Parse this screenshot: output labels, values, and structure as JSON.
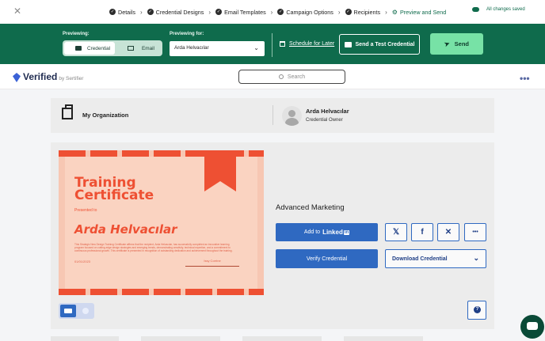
{
  "topbar": {
    "close_glyph": "✕",
    "steps": [
      {
        "label": "Details",
        "state": "done"
      },
      {
        "label": "Credential Designs",
        "state": "done"
      },
      {
        "label": "Email Templates",
        "state": "done"
      },
      {
        "label": "Campaign Options",
        "state": "done"
      },
      {
        "label": "Recipients",
        "state": "done"
      },
      {
        "label": "Preview and Send",
        "state": "active"
      }
    ],
    "saved_text": "All changes saved"
  },
  "preview": {
    "previewing_label": "Previewing:",
    "options": [
      "Credential",
      "Email"
    ],
    "selected_option": "Credential",
    "previewing_for_label": "Previewing for:",
    "recipient": "Arda Helvacılar",
    "schedule_label": "Schedule for Later",
    "test_label": "Send a Test Credential",
    "send_label": "Send"
  },
  "header": {
    "brand": "Verified",
    "brand_by": "by Sertifier",
    "search_placeholder": "Search",
    "more_glyph": "•••"
  },
  "org": {
    "name": "My Organization",
    "owner_name": "Arda Helvacılar",
    "owner_role": "Credential Owner"
  },
  "certificate": {
    "title_line1": "Training",
    "title_line2": "Certificate",
    "presented_to": "Presented to",
    "recipient": "Arda Helvacılar",
    "body": "This Strategic New Design Training Certificate affirms that the recipient, Arda Helvacılar, has successfully completed an innovative learning program focused on cutting-edge design strategies and emerging trends, demonstrating creativity, technical expertise, and a commitment to continuous professional growth. This certificate is presented in recognition of outstanding dedication and achievement throughout the training.",
    "date": "01/01/2023",
    "signature": "Issy Corrine",
    "accent_color": "#ee5033"
  },
  "credential": {
    "title": "Advanced Marketing",
    "linkedin_prefix": "Add to",
    "linkedin_word": "Linked",
    "linkedin_in": "in",
    "share_x": "𝕏",
    "share_fb": "f",
    "share_xing": "✕",
    "share_more": "•••",
    "verify_label": "Verify Credential",
    "download_label": "Download Credential"
  },
  "colors": {
    "green": "#0f6b4c",
    "send": "#77e2a6",
    "blue": "#2f69c1"
  }
}
